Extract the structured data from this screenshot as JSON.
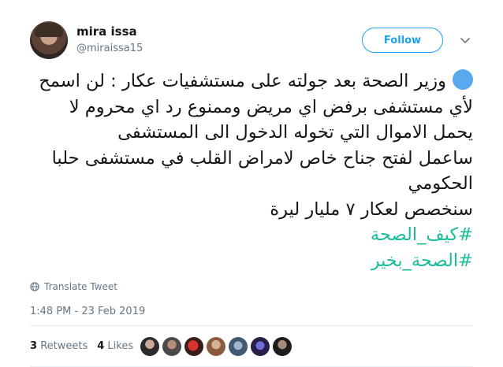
{
  "user": {
    "name": "mira issa",
    "handle": "@miraissa15"
  },
  "follow_label": "Follow",
  "tweet": {
    "lines": [
      "وزير الصحة بعد جولته على مستشفيات عكار : لن اسمح",
      "لأي مستشفى برفض اي مريض وممنوع رد اي محروم لا",
      "يحمل الاموال التي تخوله الدخول الى المستشفى",
      "ساعمل لفتح جناح خاص لامراض القلب في مستشفى حلبا",
      "الحكومي",
      "سنخصص لعكار ٧ مليار ليرة"
    ],
    "hashtags": [
      "#كيف_الصحة",
      "#الصحة_بخير"
    ]
  },
  "translate_label": "Translate Tweet",
  "timestamp": "1:48 PM - 23 Feb 2019",
  "stats": {
    "retweets_count": "3",
    "retweets_label": "Retweets",
    "likes_count": "4",
    "likes_label": "Likes"
  },
  "colors": {
    "accent": "#1da1f2",
    "hashtag": "#1bbc9b",
    "muted": "#657786",
    "emoji_circle": "#5aa9ef"
  },
  "icons": [
    "chevron-down-icon",
    "globe-icon",
    "blue-circle-emoji"
  ]
}
